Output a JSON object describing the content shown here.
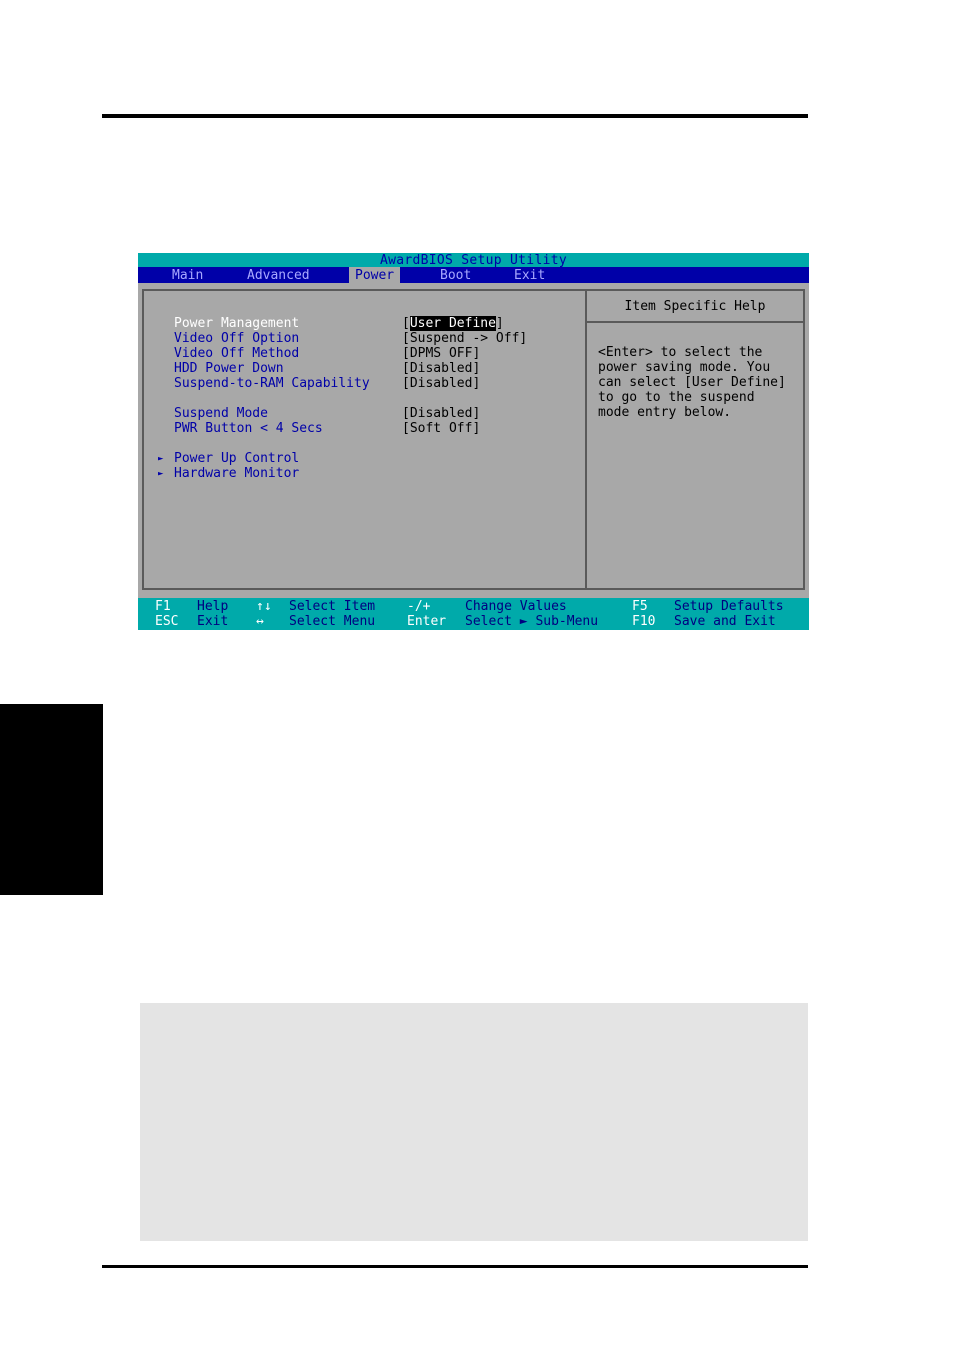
{
  "bios": {
    "title": "AwardBIOS Setup Utility",
    "menu": [
      {
        "label": "Main",
        "active": false
      },
      {
        "label": "Advanced",
        "active": false
      },
      {
        "label": "Power",
        "active": true
      },
      {
        "label": "Boot",
        "active": false
      },
      {
        "label": "Exit",
        "active": false
      }
    ],
    "items": [
      {
        "label": "Power Management",
        "value_open": "[",
        "value": "User Define",
        "value_close": "]",
        "selected": true
      },
      {
        "label": "Video Off Option",
        "value": "[Suspend -> Off]"
      },
      {
        "label": "Video Off Method",
        "value": "[DPMS OFF]"
      },
      {
        "label": "HDD Power Down",
        "value": "[Disabled]"
      },
      {
        "label": "Suspend-to-RAM Capability",
        "value": "[Disabled]"
      },
      {
        "label": "Suspend Mode",
        "value": "[Disabled]"
      },
      {
        "label": "PWR Button < 4 Secs",
        "value": "[Soft Off]"
      }
    ],
    "submenus": [
      {
        "icon": "submenu-arrow-icon",
        "glyph": "►",
        "label": "Power Up Control"
      },
      {
        "icon": "submenu-arrow-icon",
        "glyph": "►",
        "label": "Hardware Monitor"
      }
    ],
    "help": {
      "title": "Item Specific Help",
      "text": "<Enter> to select the\npower saving mode. You\ncan select [User Define]\nto go to the suspend\nmode entry below."
    },
    "footer": {
      "row1": [
        {
          "key": "F1",
          "desc": "Help"
        },
        {
          "key": "↑↓",
          "desc": "Select Item"
        },
        {
          "key": "-/+",
          "desc": "Change Values"
        },
        {
          "key": "F5",
          "desc": "Setup Defaults"
        }
      ],
      "row2": [
        {
          "key": "ESC",
          "desc": "Exit"
        },
        {
          "key": "↔",
          "desc": "Select Menu"
        },
        {
          "key": "Enter",
          "desc": "Select ► Sub-Menu"
        },
        {
          "key": "F10",
          "desc": "Save and Exit"
        }
      ]
    },
    "colors": {
      "title_bar": "#00aaaa",
      "menu_bar": "#0000a8",
      "body": "#a8a8a8",
      "item_text": "#0000a8",
      "selected_text": "#ffffff"
    }
  }
}
